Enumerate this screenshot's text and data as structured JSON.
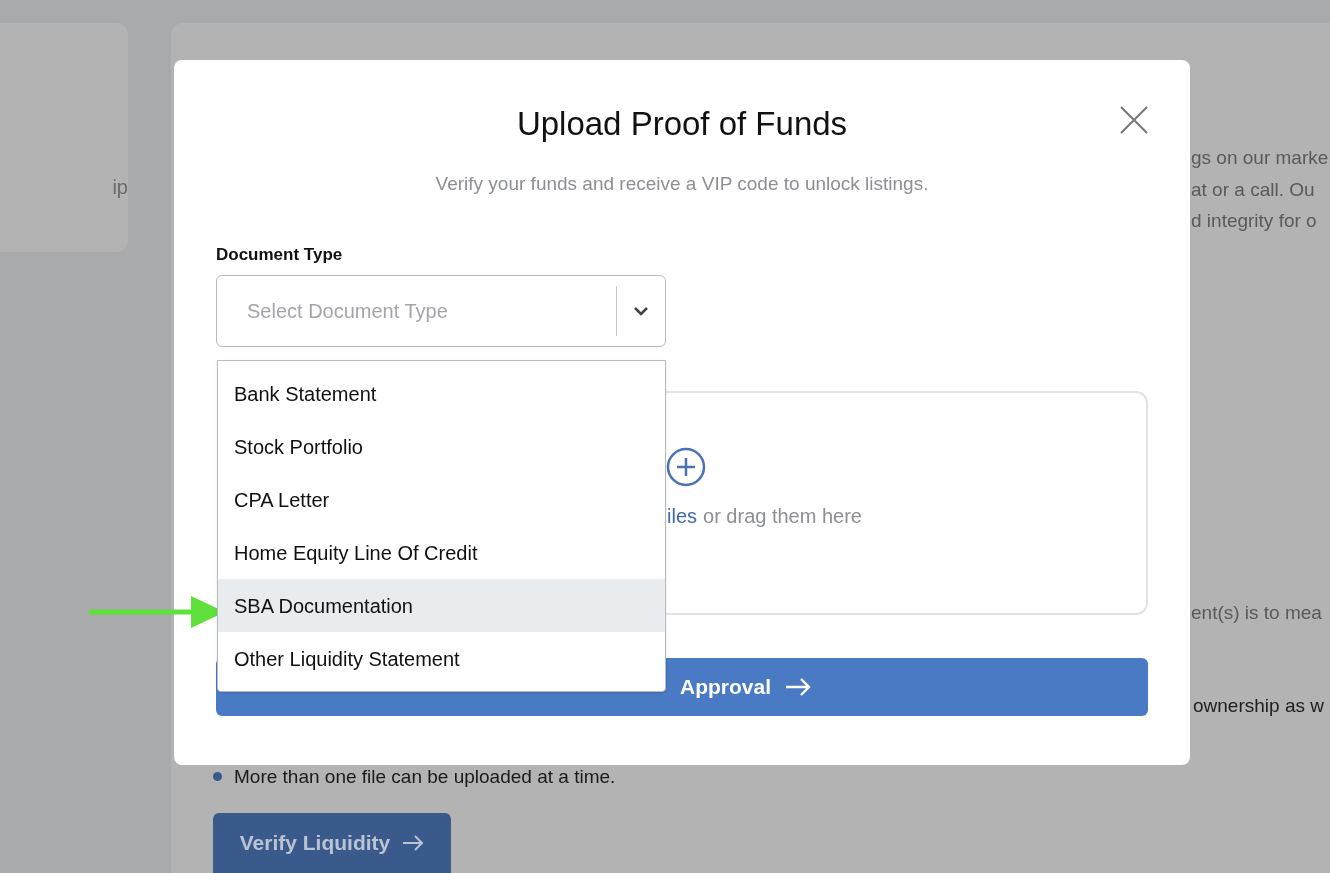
{
  "background": {
    "side_card_texts": [
      "ip"
    ],
    "intro_lines": [
      "gs on our marke",
      "at or a call. Ou",
      "d integrity for o"
    ],
    "note_line": "ent(s) is to mea",
    "ownership_line": "ownership as w",
    "bullets": [
      "More than one file can be uploaded at a time."
    ],
    "verify_button": "Verify Liquidity"
  },
  "modal": {
    "title": "Upload Proof of Funds",
    "subtitle": "Verify your funds and receive a VIP code to unlock listings.",
    "document_type": {
      "label": "Document Type",
      "placeholder": "Select Document Type",
      "expanded": true,
      "options": [
        {
          "label": "Bank Statement",
          "selected": false
        },
        {
          "label": "Stock Portfolio",
          "selected": false
        },
        {
          "label": "CPA Letter",
          "selected": false
        },
        {
          "label": "Home Equity Line Of Credit",
          "selected": false
        },
        {
          "label": "SBA Documentation",
          "selected": true
        },
        {
          "label": "Other Liquidity Statement",
          "selected": false
        }
      ]
    },
    "dropzone": {
      "link": "iles",
      "text": "or drag them here"
    },
    "submit_button": "Approval"
  }
}
